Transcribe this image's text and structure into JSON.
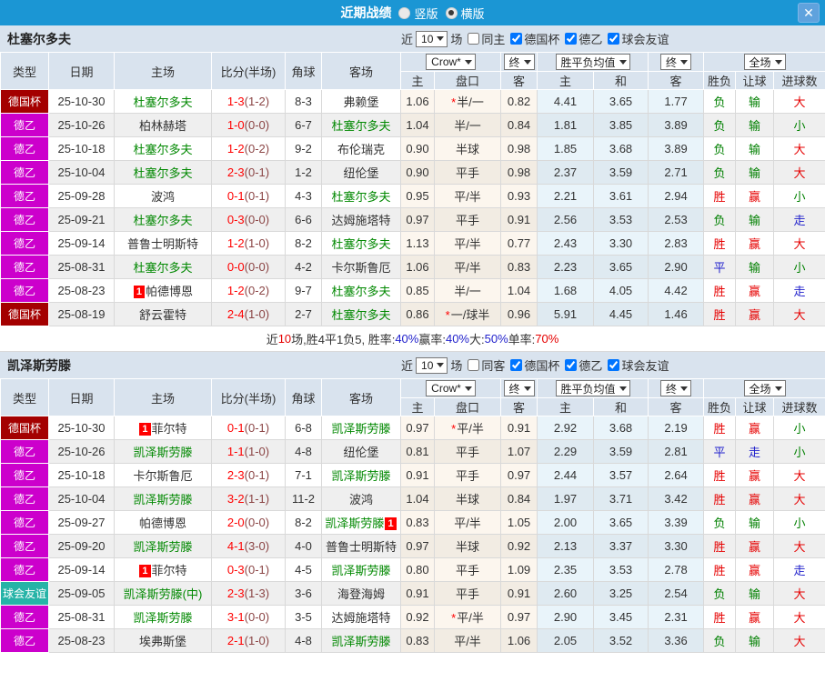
{
  "colors": {
    "accent_blue": "#1b96d4",
    "cup_badge": "#a40000",
    "league_badge": "#cc00cc",
    "friendly_badge": "#26b3a7",
    "win_red": "#e60000",
    "lose_green": "#008000",
    "draw_blue": "#2222cc",
    "subject_green": "#008800",
    "score_red": "#ff0000"
  },
  "glyphs": {
    "star": "*"
  },
  "topbar": {
    "title": "近期战绩",
    "vertical_label": "竖版",
    "horizontal_label": "横版",
    "close_label": "✕"
  },
  "header": {
    "left_cols": [
      "类型",
      "日期",
      "主场",
      "比分(半场)",
      "角球",
      "客场"
    ],
    "dropdowns": [
      {
        "label": "Crow*"
      },
      {
        "label": "终"
      },
      {
        "label": "胜平负均值"
      },
      {
        "label": "终"
      },
      {
        "label": "全场"
      }
    ],
    "sub_cols": [
      "主",
      "盘口",
      "客",
      "主",
      "和",
      "客",
      "胜负",
      "让球",
      "进球数"
    ]
  },
  "team1": {
    "name": "杜塞尔多夫",
    "filter": {
      "near": "近",
      "count": "10",
      "games": "场",
      "same": "同主",
      "same_checked": false,
      "comps": [
        {
          "label": "德国杯",
          "checked": true
        },
        {
          "label": "德乙",
          "checked": true
        },
        {
          "label": "球会友谊",
          "checked": true
        }
      ]
    },
    "rows": [
      {
        "type": "德国杯",
        "type_class": "cup",
        "date": "25-10-30",
        "home": "杜塞尔多夫",
        "home_green": true,
        "home_badge": "",
        "home_badge_pos": "",
        "score": "1-3",
        "half": "(1-2)",
        "corner": "8-3",
        "away": "弗赖堡",
        "away_green": false,
        "away_badge": "",
        "away_badge_pos": "",
        "crow_home": "1.06",
        "handicap": "半/一",
        "handicap_star": true,
        "crow_away": "0.82",
        "avg_home": "4.41",
        "avg_draw": "3.65",
        "avg_away": "1.77",
        "result": "负",
        "result_class": "green",
        "handicap_res": "输",
        "handicap_res_class": "green",
        "goal": "大",
        "goal_class": "red"
      },
      {
        "type": "德乙",
        "type_class": "d2",
        "date": "25-10-26",
        "home": "柏林赫塔",
        "home_green": false,
        "home_badge": "",
        "home_badge_pos": "",
        "score": "1-0",
        "half": "(0-0)",
        "corner": "6-7",
        "away": "杜塞尔多夫",
        "away_green": true,
        "away_badge": "",
        "away_badge_pos": "",
        "crow_home": "1.04",
        "handicap": "半/一",
        "handicap_star": false,
        "crow_away": "0.84",
        "avg_home": "1.81",
        "avg_draw": "3.85",
        "avg_away": "3.89",
        "result": "负",
        "result_class": "green",
        "handicap_res": "输",
        "handicap_res_class": "green",
        "goal": "小",
        "goal_class": "green"
      },
      {
        "type": "德乙",
        "type_class": "d2",
        "date": "25-10-18",
        "home": "杜塞尔多夫",
        "home_green": true,
        "home_badge": "",
        "home_badge_pos": "",
        "score": "1-2",
        "half": "(0-2)",
        "corner": "9-2",
        "away": "布伦瑞克",
        "away_green": false,
        "away_badge": "",
        "away_badge_pos": "",
        "crow_home": "0.90",
        "handicap": "半球",
        "handicap_star": false,
        "crow_away": "0.98",
        "avg_home": "1.85",
        "avg_draw": "3.68",
        "avg_away": "3.89",
        "result": "负",
        "result_class": "green",
        "handicap_res": "输",
        "handicap_res_class": "green",
        "goal": "大",
        "goal_class": "red"
      },
      {
        "type": "德乙",
        "type_class": "d2",
        "date": "25-10-04",
        "home": "杜塞尔多夫",
        "home_green": true,
        "home_badge": "",
        "home_badge_pos": "",
        "score": "2-3",
        "half": "(0-1)",
        "corner": "1-2",
        "away": "纽伦堡",
        "away_green": false,
        "away_badge": "",
        "away_badge_pos": "",
        "crow_home": "0.90",
        "handicap": "平手",
        "handicap_star": false,
        "crow_away": "0.98",
        "avg_home": "2.37",
        "avg_draw": "3.59",
        "avg_away": "2.71",
        "result": "负",
        "result_class": "green",
        "handicap_res": "输",
        "handicap_res_class": "green",
        "goal": "大",
        "goal_class": "red"
      },
      {
        "type": "德乙",
        "type_class": "d2",
        "date": "25-09-28",
        "home": "波鸿",
        "home_green": false,
        "home_badge": "",
        "home_badge_pos": "",
        "score": "0-1",
        "half": "(0-1)",
        "corner": "4-3",
        "away": "杜塞尔多夫",
        "away_green": true,
        "away_badge": "",
        "away_badge_pos": "",
        "crow_home": "0.95",
        "handicap": "平/半",
        "handicap_star": false,
        "crow_away": "0.93",
        "avg_home": "2.21",
        "avg_draw": "3.61",
        "avg_away": "2.94",
        "result": "胜",
        "result_class": "red",
        "handicap_res": "赢",
        "handicap_res_class": "red",
        "goal": "小",
        "goal_class": "green"
      },
      {
        "type": "德乙",
        "type_class": "d2",
        "date": "25-09-21",
        "home": "杜塞尔多夫",
        "home_green": true,
        "home_badge": "",
        "home_badge_pos": "",
        "score": "0-3",
        "half": "(0-0)",
        "corner": "6-6",
        "away": "达姆施塔特",
        "away_green": false,
        "away_badge": "",
        "away_badge_pos": "",
        "crow_home": "0.97",
        "handicap": "平手",
        "handicap_star": false,
        "crow_away": "0.91",
        "avg_home": "2.56",
        "avg_draw": "3.53",
        "avg_away": "2.53",
        "result": "负",
        "result_class": "green",
        "handicap_res": "输",
        "handicap_res_class": "green",
        "goal": "走",
        "goal_class": "blue"
      },
      {
        "type": "德乙",
        "type_class": "d2",
        "date": "25-09-14",
        "home": "普鲁士明斯特",
        "home_green": false,
        "home_badge": "",
        "home_badge_pos": "",
        "score": "1-2",
        "half": "(1-0)",
        "corner": "8-2",
        "away": "杜塞尔多夫",
        "away_green": true,
        "away_badge": "",
        "away_badge_pos": "",
        "crow_home": "1.13",
        "handicap": "平/半",
        "handicap_star": false,
        "crow_away": "0.77",
        "avg_home": "2.43",
        "avg_draw": "3.30",
        "avg_away": "2.83",
        "result": "胜",
        "result_class": "red",
        "handicap_res": "赢",
        "handicap_res_class": "red",
        "goal": "大",
        "goal_class": "red"
      },
      {
        "type": "德乙",
        "type_class": "d2",
        "date": "25-08-31",
        "home": "杜塞尔多夫",
        "home_green": true,
        "home_badge": "",
        "home_badge_pos": "",
        "score": "0-0",
        "half": "(0-0)",
        "corner": "4-2",
        "away": "卡尔斯鲁厄",
        "away_green": false,
        "away_badge": "",
        "away_badge_pos": "",
        "crow_home": "1.06",
        "handicap": "平/半",
        "handicap_star": false,
        "crow_away": "0.83",
        "avg_home": "2.23",
        "avg_draw": "3.65",
        "avg_away": "2.90",
        "result": "平",
        "result_class": "blue",
        "handicap_res": "输",
        "handicap_res_class": "green",
        "goal": "小",
        "goal_class": "green"
      },
      {
        "type": "德乙",
        "type_class": "d2",
        "date": "25-08-23",
        "home": "帕德博恩",
        "home_green": false,
        "home_badge": "1",
        "home_badge_pos": "before",
        "score": "1-2",
        "half": "(0-2)",
        "corner": "9-7",
        "away": "杜塞尔多夫",
        "away_green": true,
        "away_badge": "",
        "away_badge_pos": "",
        "crow_home": "0.85",
        "handicap": "半/一",
        "handicap_star": false,
        "crow_away": "1.04",
        "avg_home": "1.68",
        "avg_draw": "4.05",
        "avg_away": "4.42",
        "result": "胜",
        "result_class": "red",
        "handicap_res": "赢",
        "handicap_res_class": "red",
        "goal": "走",
        "goal_class": "blue"
      },
      {
        "type": "德国杯",
        "type_class": "cup",
        "date": "25-08-19",
        "home": "舒云霍特",
        "home_green": false,
        "home_badge": "",
        "home_badge_pos": "",
        "score": "2-4",
        "half": "(1-0)",
        "corner": "2-7",
        "away": "杜塞尔多夫",
        "away_green": true,
        "away_badge": "",
        "away_badge_pos": "",
        "crow_home": "0.86",
        "handicap": "一/球半",
        "handicap_star": true,
        "crow_away": "0.96",
        "avg_home": "5.91",
        "avg_draw": "4.45",
        "avg_away": "1.46",
        "result": "胜",
        "result_class": "red",
        "handicap_res": "赢",
        "handicap_res_class": "red",
        "goal": "大",
        "goal_class": "red"
      }
    ],
    "summary": [
      {
        "text": "近",
        "color": ""
      },
      {
        "text": "10",
        "color": "red"
      },
      {
        "text": "场,胜4平1负5, 胜率:",
        "color": ""
      },
      {
        "text": "40%",
        "color": "blue"
      },
      {
        "text": " 赢率:",
        "color": ""
      },
      {
        "text": "40%",
        "color": "blue"
      },
      {
        "text": " 大:",
        "color": ""
      },
      {
        "text": "50%",
        "color": "blue"
      },
      {
        "text": " 单率:",
        "color": ""
      },
      {
        "text": "70%",
        "color": "red"
      }
    ]
  },
  "team2": {
    "name": "凯泽斯劳滕",
    "filter": {
      "near": "近",
      "count": "10",
      "games": "场",
      "same": "同客",
      "same_checked": false,
      "comps": [
        {
          "label": "德国杯",
          "checked": true
        },
        {
          "label": "德乙",
          "checked": true
        },
        {
          "label": "球会友谊",
          "checked": true
        }
      ]
    },
    "rows": [
      {
        "type": "德国杯",
        "type_class": "cup",
        "date": "25-10-30",
        "home": "菲尔特",
        "home_green": false,
        "home_badge": "1",
        "home_badge_pos": "before",
        "score": "0-1",
        "half": "(0-1)",
        "corner": "6-8",
        "away": "凯泽斯劳滕",
        "away_green": true,
        "away_badge": "",
        "away_badge_pos": "",
        "crow_home": "0.97",
        "handicap": "平/半",
        "handicap_star": true,
        "crow_away": "0.91",
        "avg_home": "2.92",
        "avg_draw": "3.68",
        "avg_away": "2.19",
        "result": "胜",
        "result_class": "red",
        "handicap_res": "赢",
        "handicap_res_class": "red",
        "goal": "小",
        "goal_class": "green"
      },
      {
        "type": "德乙",
        "type_class": "d2",
        "date": "25-10-26",
        "home": "凯泽斯劳滕",
        "home_green": true,
        "home_badge": "",
        "home_badge_pos": "",
        "score": "1-1",
        "half": "(1-0)",
        "corner": "4-8",
        "away": "纽伦堡",
        "away_green": false,
        "away_badge": "",
        "away_badge_pos": "",
        "crow_home": "0.81",
        "handicap": "平手",
        "handicap_star": false,
        "crow_away": "1.07",
        "avg_home": "2.29",
        "avg_draw": "3.59",
        "avg_away": "2.81",
        "result": "平",
        "result_class": "blue",
        "handicap_res": "走",
        "handicap_res_class": "blue",
        "goal": "小",
        "goal_class": "green"
      },
      {
        "type": "德乙",
        "type_class": "d2",
        "date": "25-10-18",
        "home": "卡尔斯鲁厄",
        "home_green": false,
        "home_badge": "",
        "home_badge_pos": "",
        "score": "2-3",
        "half": "(0-1)",
        "corner": "7-1",
        "away": "凯泽斯劳滕",
        "away_green": true,
        "away_badge": "",
        "away_badge_pos": "",
        "crow_home": "0.91",
        "handicap": "平手",
        "handicap_star": false,
        "crow_away": "0.97",
        "avg_home": "2.44",
        "avg_draw": "3.57",
        "avg_away": "2.64",
        "result": "胜",
        "result_class": "red",
        "handicap_res": "赢",
        "handicap_res_class": "red",
        "goal": "大",
        "goal_class": "red"
      },
      {
        "type": "德乙",
        "type_class": "d2",
        "date": "25-10-04",
        "home": "凯泽斯劳滕",
        "home_green": true,
        "home_badge": "",
        "home_badge_pos": "",
        "score": "3-2",
        "half": "(1-1)",
        "corner": "11-2",
        "away": "波鸿",
        "away_green": false,
        "away_badge": "",
        "away_badge_pos": "",
        "crow_home": "1.04",
        "handicap": "半球",
        "handicap_star": false,
        "crow_away": "0.84",
        "avg_home": "1.97",
        "avg_draw": "3.71",
        "avg_away": "3.42",
        "result": "胜",
        "result_class": "red",
        "handicap_res": "赢",
        "handicap_res_class": "red",
        "goal": "大",
        "goal_class": "red"
      },
      {
        "type": "德乙",
        "type_class": "d2",
        "date": "25-09-27",
        "home": "帕德博恩",
        "home_green": false,
        "home_badge": "",
        "home_badge_pos": "",
        "score": "2-0",
        "half": "(0-0)",
        "corner": "8-2",
        "away": "凯泽斯劳滕",
        "away_green": true,
        "away_badge": "1",
        "away_badge_pos": "after",
        "crow_home": "0.83",
        "handicap": "平/半",
        "handicap_star": false,
        "crow_away": "1.05",
        "avg_home": "2.00",
        "avg_draw": "3.65",
        "avg_away": "3.39",
        "result": "负",
        "result_class": "green",
        "handicap_res": "输",
        "handicap_res_class": "green",
        "goal": "小",
        "goal_class": "green"
      },
      {
        "type": "德乙",
        "type_class": "d2",
        "date": "25-09-20",
        "home": "凯泽斯劳滕",
        "home_green": true,
        "home_badge": "",
        "home_badge_pos": "",
        "score": "4-1",
        "half": "(3-0)",
        "corner": "4-0",
        "away": "普鲁士明斯特",
        "away_green": false,
        "away_badge": "",
        "away_badge_pos": "",
        "crow_home": "0.97",
        "handicap": "半球",
        "handicap_star": false,
        "crow_away": "0.92",
        "avg_home": "2.13",
        "avg_draw": "3.37",
        "avg_away": "3.30",
        "result": "胜",
        "result_class": "red",
        "handicap_res": "赢",
        "handicap_res_class": "red",
        "goal": "大",
        "goal_class": "red"
      },
      {
        "type": "德乙",
        "type_class": "d2",
        "date": "25-09-14",
        "home": "菲尔特",
        "home_green": false,
        "home_badge": "1",
        "home_badge_pos": "before",
        "score": "0-3",
        "half": "(0-1)",
        "corner": "4-5",
        "away": "凯泽斯劳滕",
        "away_green": true,
        "away_badge": "",
        "away_badge_pos": "",
        "crow_home": "0.80",
        "handicap": "平手",
        "handicap_star": false,
        "crow_away": "1.09",
        "avg_home": "2.35",
        "avg_draw": "3.53",
        "avg_away": "2.78",
        "result": "胜",
        "result_class": "red",
        "handicap_res": "赢",
        "handicap_res_class": "red",
        "goal": "走",
        "goal_class": "blue"
      },
      {
        "type": "球会友谊",
        "type_class": "friendly",
        "date": "25-09-05",
        "home": "凯泽斯劳滕(中)",
        "home_green": true,
        "home_badge": "",
        "home_badge_pos": "",
        "score": "2-3",
        "half": "(1-3)",
        "corner": "3-6",
        "away": "海登海姆",
        "away_green": false,
        "away_badge": "",
        "away_badge_pos": "",
        "crow_home": "0.91",
        "handicap": "平手",
        "handicap_star": false,
        "crow_away": "0.91",
        "avg_home": "2.60",
        "avg_draw": "3.25",
        "avg_away": "2.54",
        "result": "负",
        "result_class": "green",
        "handicap_res": "输",
        "handicap_res_class": "green",
        "goal": "大",
        "goal_class": "red"
      },
      {
        "type": "德乙",
        "type_class": "d2",
        "date": "25-08-31",
        "home": "凯泽斯劳滕",
        "home_green": true,
        "home_badge": "",
        "home_badge_pos": "",
        "score": "3-1",
        "half": "(0-0)",
        "corner": "3-5",
        "away": "达姆施塔特",
        "away_green": false,
        "away_badge": "",
        "away_badge_pos": "",
        "crow_home": "0.92",
        "handicap": "平/半",
        "handicap_star": true,
        "crow_away": "0.97",
        "avg_home": "2.90",
        "avg_draw": "3.45",
        "avg_away": "2.31",
        "result": "胜",
        "result_class": "red",
        "handicap_res": "赢",
        "handicap_res_class": "red",
        "goal": "大",
        "goal_class": "red"
      },
      {
        "type": "德乙",
        "type_class": "d2",
        "date": "25-08-23",
        "home": "埃弗斯堡",
        "home_green": false,
        "home_badge": "",
        "home_badge_pos": "",
        "score": "2-1",
        "half": "(1-0)",
        "corner": "4-8",
        "away": "凯泽斯劳滕",
        "away_green": true,
        "away_badge": "",
        "away_badge_pos": "",
        "crow_home": "0.83",
        "handicap": "平/半",
        "handicap_star": false,
        "crow_away": "1.06",
        "avg_home": "2.05",
        "avg_draw": "3.52",
        "avg_away": "3.36",
        "result": "负",
        "result_class": "green",
        "handicap_res": "输",
        "handicap_res_class": "green",
        "goal": "大",
        "goal_class": "red"
      }
    ]
  }
}
